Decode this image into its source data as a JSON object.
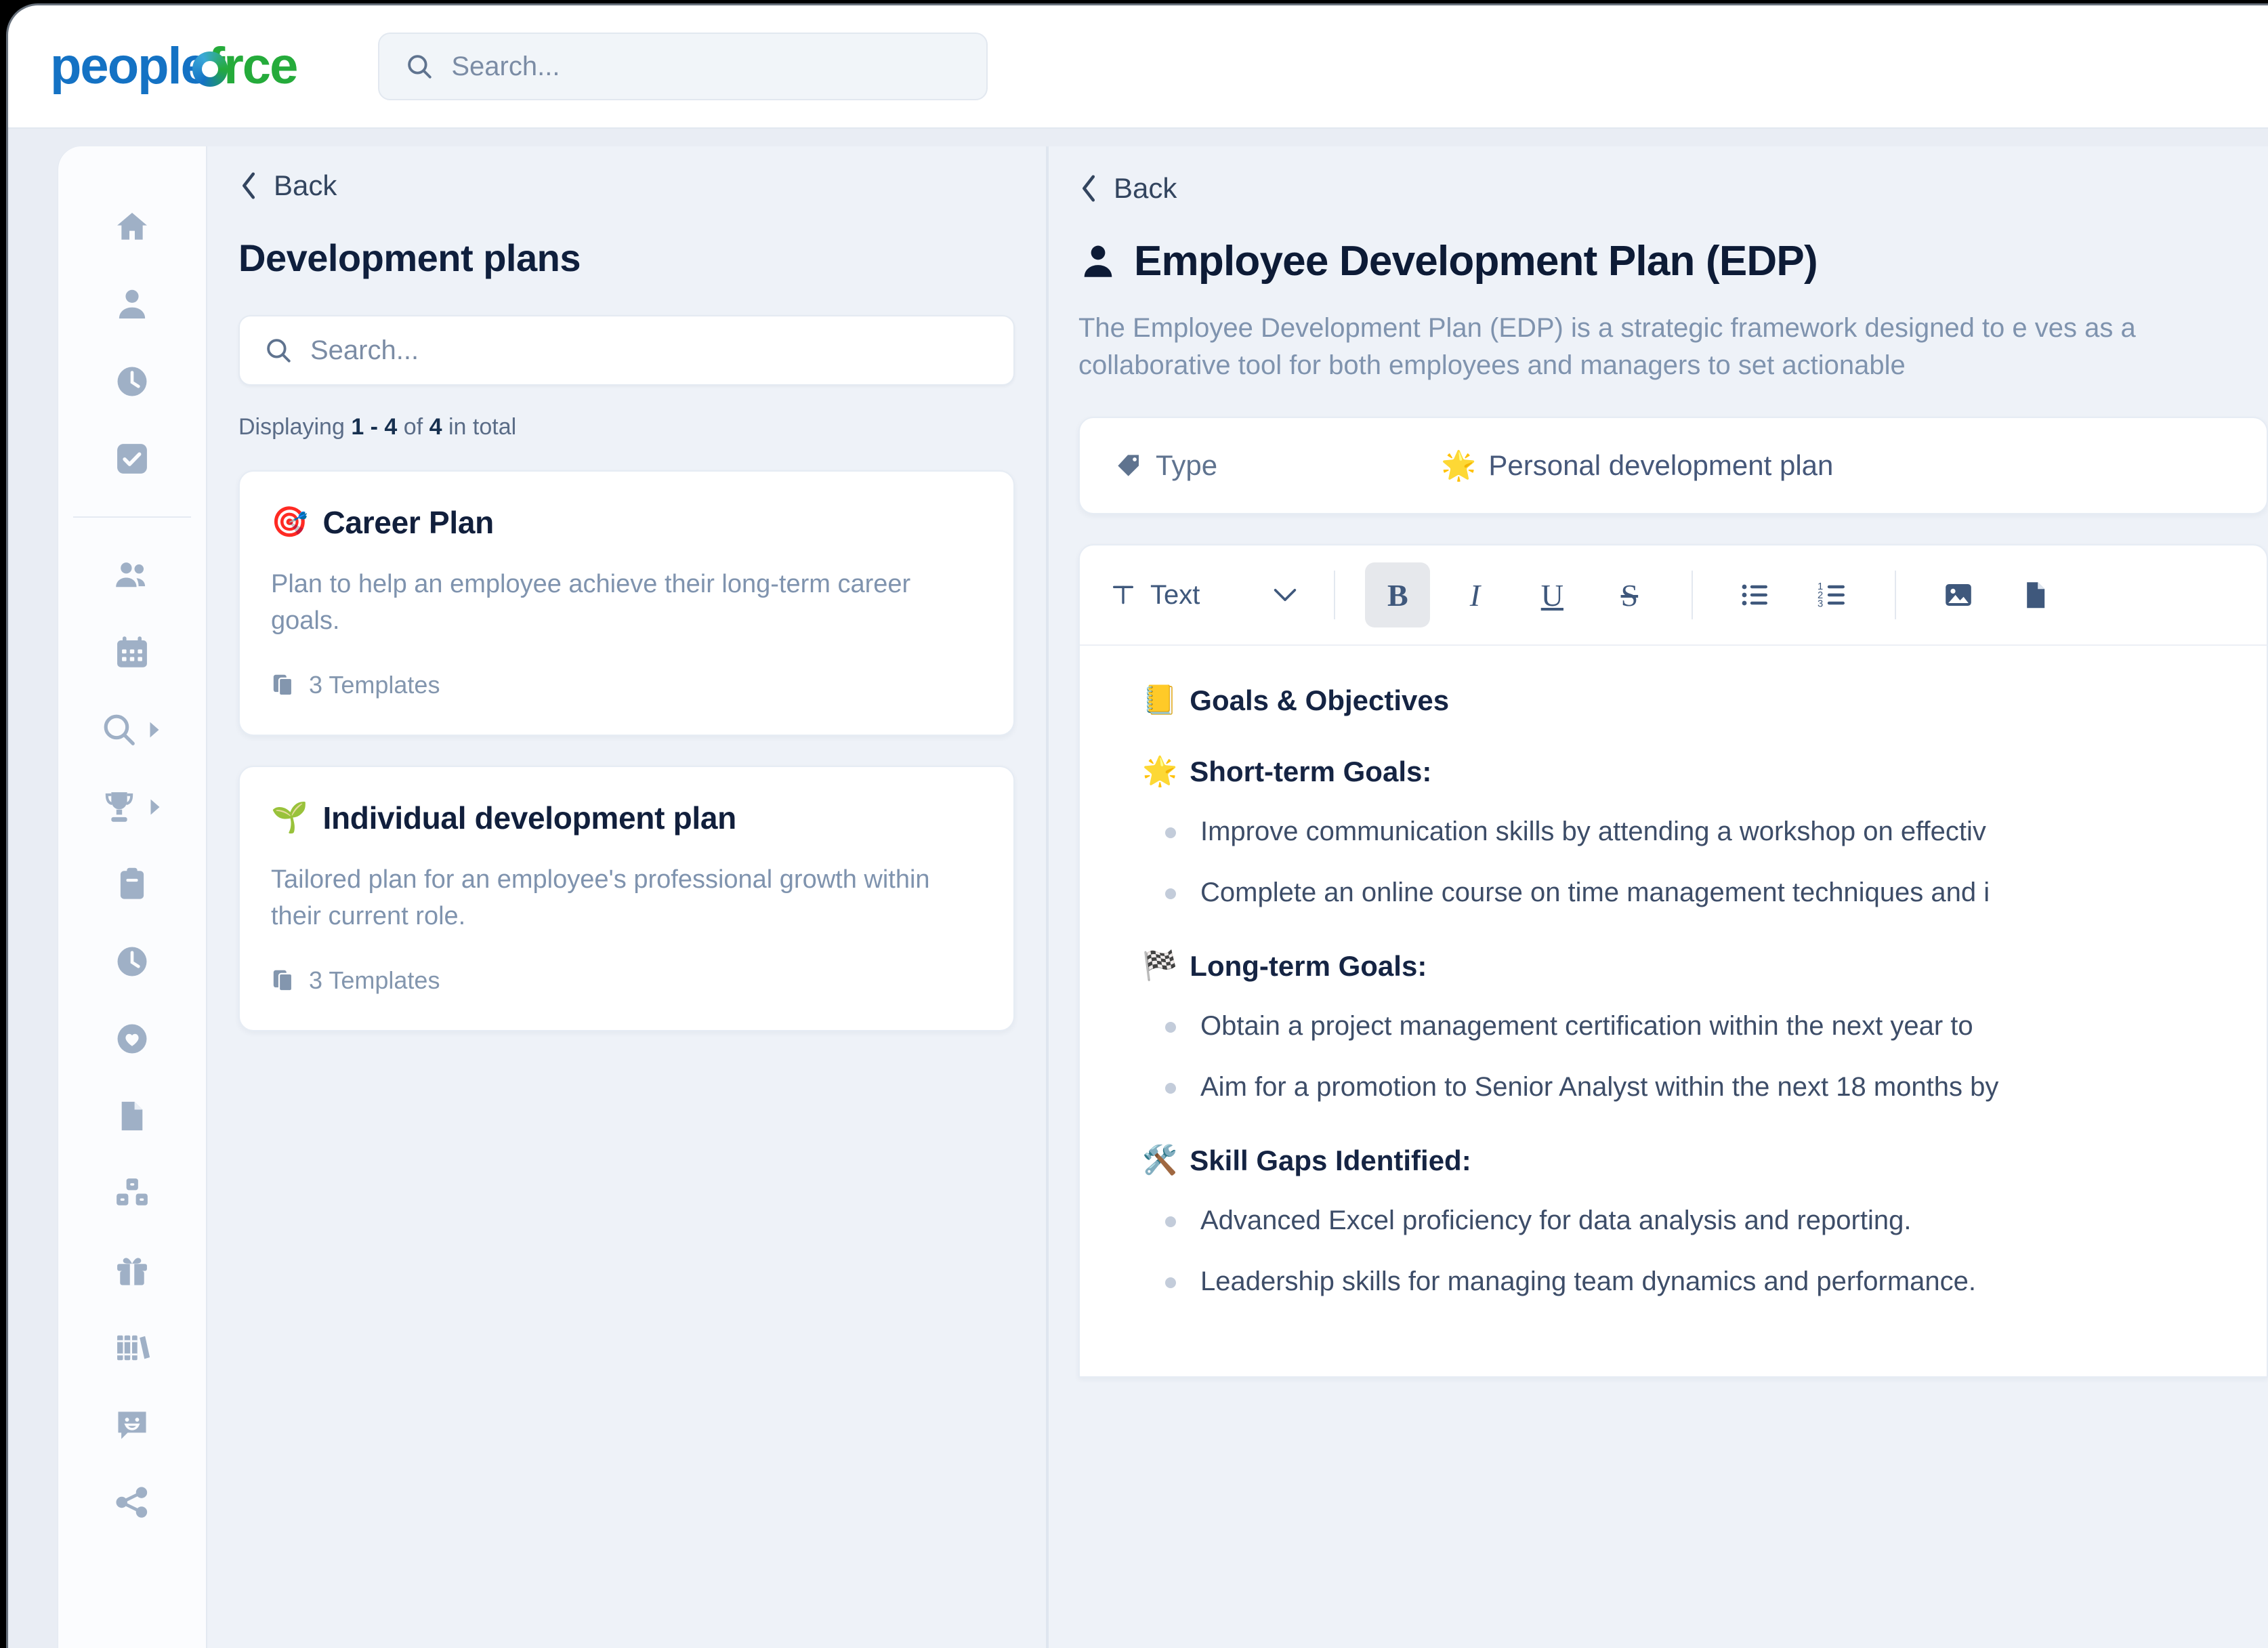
{
  "topbar": {
    "logo_part1": "people",
    "logo_part2": "f",
    "logo_part3": "rce",
    "search_placeholder": "Search..."
  },
  "rail": {
    "items": [
      {
        "icon": "home-icon",
        "name": "home"
      },
      {
        "icon": "person-icon",
        "name": "person"
      },
      {
        "icon": "clock-icon",
        "name": "time"
      },
      {
        "icon": "checkbox-icon",
        "name": "tasks"
      },
      {
        "icon": "people-icon",
        "name": "people"
      },
      {
        "icon": "calendar-icon",
        "name": "calendar"
      },
      {
        "icon": "magnifier-icon",
        "name": "recruitment"
      },
      {
        "icon": "trophy-icon",
        "name": "performance"
      },
      {
        "icon": "clipboard-icon",
        "name": "clipboard"
      },
      {
        "icon": "clock-filled-icon",
        "name": "timesheet"
      },
      {
        "icon": "heart-icon",
        "name": "wellbeing"
      },
      {
        "icon": "document-icon",
        "name": "documents"
      },
      {
        "icon": "cubes-icon",
        "name": "assets"
      },
      {
        "icon": "gift-icon",
        "name": "benefits"
      },
      {
        "icon": "books-icon",
        "name": "learning"
      },
      {
        "icon": "chat-icon",
        "name": "feedback"
      },
      {
        "icon": "share-icon",
        "name": "share"
      }
    ]
  },
  "list_panel": {
    "back_label": "Back",
    "title": "Development plans",
    "search_placeholder": "Search...",
    "displaying_prefix": "Displaying ",
    "displaying_range": "1 - 4",
    "displaying_mid": " of ",
    "displaying_total": "4",
    "displaying_suffix": " in total",
    "cards": [
      {
        "emoji": "🎯",
        "title": "Career Plan",
        "description": "Plan to help an employee achieve their long-term career goals.",
        "templates": "3 Templates"
      },
      {
        "emoji": "🌱",
        "title": "Individual development plan",
        "description": "Tailored plan for an employee's professional growth within their current role.",
        "templates": "3 Templates"
      }
    ]
  },
  "detail_panel": {
    "back_label": "Back",
    "title": "Employee Development Plan (EDP)",
    "description": "The Employee Development Plan (EDP) is a strategic framework designed to e ves as a collaborative tool for both employees and managers to set actionable",
    "type_label": "Type",
    "type_emoji": "🌟",
    "type_value": "Personal development plan",
    "toolbar": {
      "style_label": "Text",
      "bold_label": "B",
      "italic_label": "I",
      "underline_label": "U",
      "strike_label": "S"
    },
    "document": {
      "sections": [
        {
          "emoji": "📒",
          "heading": "Goals & Objectives",
          "items": []
        },
        {
          "emoji": "🌟",
          "heading": "Short-term Goals:",
          "items": [
            "Improve communication skills by attending a workshop on effectiv",
            "Complete an online course on time management techniques and i"
          ]
        },
        {
          "emoji": "🏁",
          "heading": "Long-term Goals:",
          "items": [
            "Obtain a project management certification within the next year to",
            "Aim for a promotion to Senior Analyst within the next 18 months by"
          ]
        },
        {
          "emoji": "🛠️",
          "heading": "Skill Gaps Identified:",
          "items": [
            "Advanced Excel proficiency for data analysis and reporting.",
            "Leadership skills for managing team dynamics and performance."
          ]
        }
      ]
    }
  },
  "colors": {
    "brand_blue": "#1472c4",
    "brand_green": "#25ab3b",
    "page_bg": "#eef2f8",
    "text_dark": "#0d1b36",
    "text_muted": "#7f93ae"
  }
}
